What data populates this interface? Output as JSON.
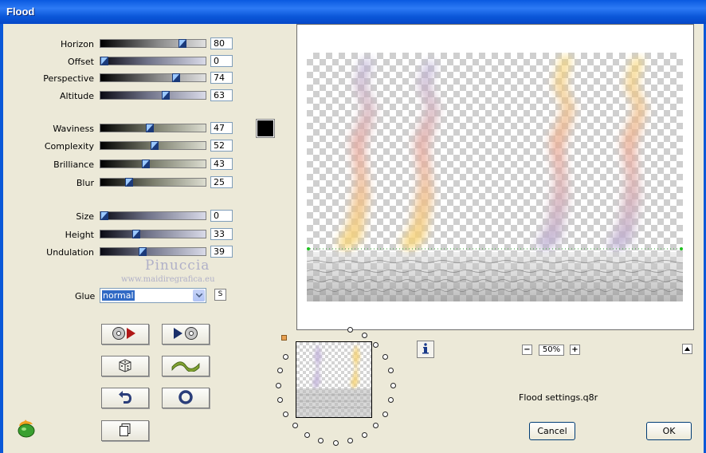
{
  "window": {
    "title": "Flood"
  },
  "params": [
    {
      "label": "Horizon",
      "value": "80",
      "fraction": 0.8
    },
    {
      "label": "Offset",
      "value": "0",
      "fraction": 0.0
    },
    {
      "label": "Perspective",
      "value": "74",
      "fraction": 0.74
    },
    {
      "label": "Altitude",
      "value": "63",
      "fraction": 0.63
    },
    {
      "label": "Waviness",
      "value": "47",
      "fraction": 0.47
    },
    {
      "label": "Complexity",
      "value": "52",
      "fraction": 0.52
    },
    {
      "label": "Brilliance",
      "value": "43",
      "fraction": 0.43
    },
    {
      "label": "Blur",
      "value": "25",
      "fraction": 0.25
    },
    {
      "label": "Size",
      "value": "0",
      "fraction": 0.0
    },
    {
      "label": "Height",
      "value": "33",
      "fraction": 0.33
    },
    {
      "label": "Undulation",
      "value": "39",
      "fraction": 0.39
    }
  ],
  "color_swatch": "#000000",
  "watermark": {
    "line1": "Pinuccia",
    "line2": "www.maidiregrafica.eu"
  },
  "glue": {
    "label": "Glue",
    "value": "normal",
    "s_button": "S"
  },
  "zoom": {
    "value": "50%",
    "minus": "−",
    "plus": "+"
  },
  "settings_file": "Flood settings.q8r",
  "buttons": {
    "cancel": "Cancel",
    "ok": "OK"
  }
}
